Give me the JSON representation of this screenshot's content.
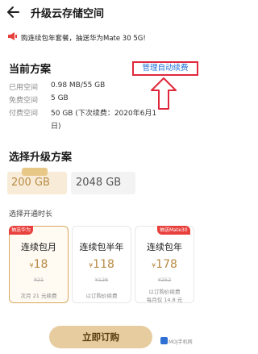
{
  "header": {
    "title": "升级云存储空间",
    "back_icon": "arrow-left-icon"
  },
  "promo": {
    "icon": "megaphone-icon",
    "text": "购连续包年套餐，抽送华为Mate 30 5G!"
  },
  "current_plan": {
    "title": "当前方案",
    "manage_link": "管理自动续费",
    "annotation_arrow_color": "#e0283c",
    "rows": [
      {
        "label": "已用空间",
        "value": "0.98 MB/55 GB"
      },
      {
        "label": "免费空间",
        "value": "5 GB"
      },
      {
        "label": "付费空间",
        "value": "50 GB (下次续费：2020年6月1",
        "value_cont": "日)"
      }
    ]
  },
  "upgrade": {
    "title": "选择升级方案",
    "capacities": [
      {
        "label": "200 GB",
        "badge": "",
        "selected": true
      },
      {
        "label": "2048 GB",
        "badge": "",
        "selected": false
      }
    ]
  },
  "duration": {
    "title": "选择开通时长",
    "plans": [
      {
        "badge": "抽送华为",
        "name": "连续包月",
        "currency": "¥",
        "price": "18",
        "original": "¥21",
        "note": "次月 21 元续费",
        "selected": true
      },
      {
        "badge": "",
        "name": "连续包半年",
        "currency": "¥",
        "price": "118",
        "original": "¥126",
        "note": "以订购价续费",
        "selected": false
      },
      {
        "badge": "抽送Mate30",
        "name": "连续包年",
        "currency": "¥",
        "price": "178",
        "original": "¥252",
        "note": "以订购价续费",
        "note2": "每月仅 14.8 元",
        "selected": false
      }
    ]
  },
  "footer": {
    "buy_label": "立即订购",
    "watermark": "MOJ手机网"
  },
  "colors": {
    "accent_gold": "#b88a44",
    "link_blue": "#1f6fd6",
    "highlight_red": "#e0283c",
    "button_bg": "#e7cca0"
  }
}
